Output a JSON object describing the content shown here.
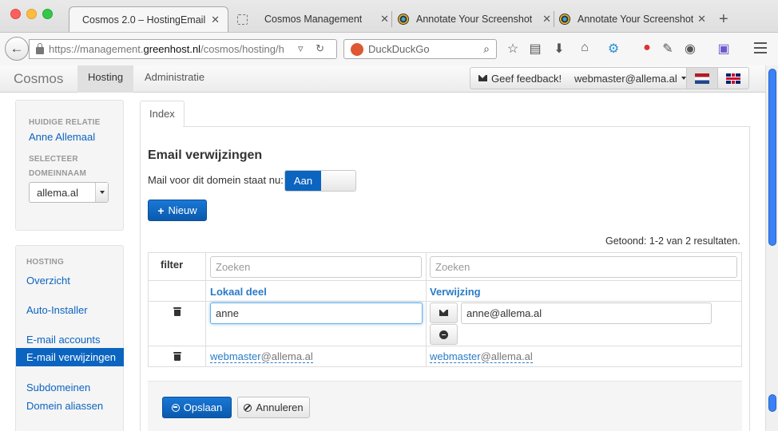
{
  "browser": {
    "tabs": [
      {
        "label": "Cosmos 2.0 – HostingEmail"
      },
      {
        "label": "Cosmos Management"
      },
      {
        "label": "Annotate Your Screenshot"
      },
      {
        "label": "Annotate Your Screenshot"
      }
    ],
    "url_prefix": "https://management.",
    "url_domain": "greenhost.nl",
    "url_rest": "/cosmos/hosting/h",
    "search_placeholder": "DuckDuckGo"
  },
  "navbar": {
    "brand": "Cosmos",
    "items": [
      {
        "label": "Hosting"
      },
      {
        "label": "Administratie"
      }
    ],
    "feedback_label": "Geef feedback!",
    "user_label": "webmaster@allema.al"
  },
  "sidebar": {
    "relation_heading": "HUIDIGE RELATIE",
    "relation_name": "Anne Allemaal",
    "select_heading_1": "SELECTEER",
    "select_heading_2": "DOMEINNAAM",
    "domain_value": "allema.al",
    "hosting_heading": "HOSTING",
    "links": [
      {
        "label": "Overzicht"
      },
      {
        "label": "Auto-Installer"
      },
      {
        "label": "E-mail accounts"
      },
      {
        "label": "E-mail verwijzingen"
      },
      {
        "label": "Subdomeinen"
      },
      {
        "label": "Domein aliassen"
      }
    ]
  },
  "main": {
    "tab_label": "Index",
    "title": "Email verwijzingen",
    "mail_status_label": "Mail voor dit domein staat nu:",
    "toggle_on_label": "Aan",
    "new_button": "Nieuw",
    "results_text": "Getoond: 1-2 van 2 resultaten.",
    "table": {
      "filter_label": "filter",
      "filter_local_placeholder": "Zoeken",
      "filter_target_placeholder": "Zoeken",
      "col_local": "Lokaal deel",
      "col_target": "Verwijzing",
      "edit_row": {
        "local_value": "anne",
        "target_value": "anne@allema.al"
      },
      "rows": [
        {
          "local_name": "webmaster",
          "local_domain": "@allema.al",
          "target_name": "webmaster",
          "target_domain": "@allema.al"
        }
      ]
    },
    "save_button": "Opslaan",
    "cancel_button": "Annuleren"
  },
  "colors": {
    "primary": "#0b64c0",
    "link": "#2a7bc7"
  }
}
